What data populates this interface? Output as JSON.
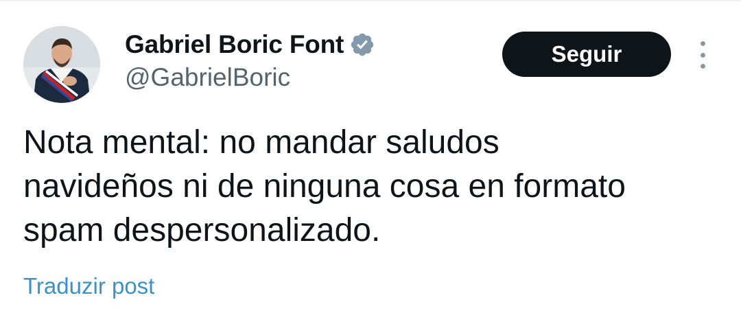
{
  "user": {
    "display_name": "Gabriel Boric Font",
    "handle": "@GabrielBoric",
    "verified_icon": "verified-badge-icon"
  },
  "actions": {
    "follow_label": "Seguir",
    "more_icon": "more-vertical-icon"
  },
  "post": {
    "lines": [
      "Nota mental: no mandar saludos",
      "navideños ni de ninguna cosa en formato",
      "spam despersonalizado."
    ]
  },
  "translate": {
    "label": "Traduzir post"
  },
  "colors": {
    "text": "#0f1419",
    "secondary": "#536471",
    "button_bg": "#0f1419",
    "link": "#3b92c9",
    "verified": "#829aab"
  }
}
